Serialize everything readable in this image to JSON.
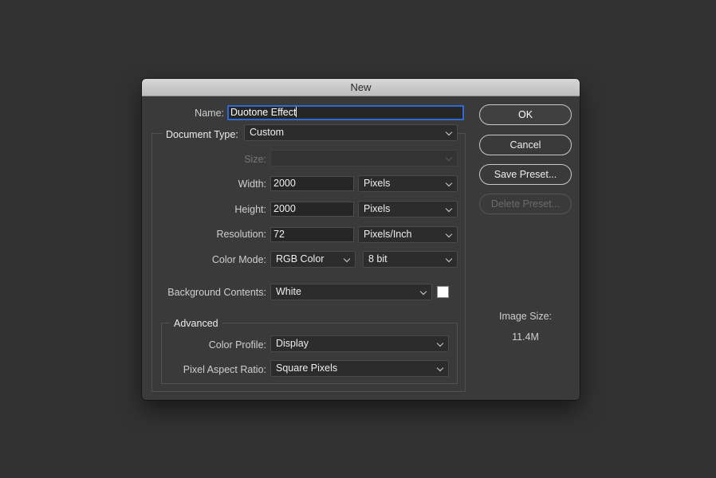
{
  "dialog": {
    "title": "New"
  },
  "name": {
    "label": "Name:",
    "value": "Duotone Effect"
  },
  "document_type": {
    "label": "Document Type:",
    "value": "Custom"
  },
  "size": {
    "label": "Size:",
    "value": ""
  },
  "width": {
    "label": "Width:",
    "value": "2000",
    "unit": "Pixels"
  },
  "height": {
    "label": "Height:",
    "value": "2000",
    "unit": "Pixels"
  },
  "resolution": {
    "label": "Resolution:",
    "value": "72",
    "unit": "Pixels/Inch"
  },
  "color_mode": {
    "label": "Color Mode:",
    "value": "RGB Color",
    "depth": "8 bit"
  },
  "background": {
    "label": "Background Contents:",
    "value": "White",
    "swatch_color": "#ffffff"
  },
  "advanced": {
    "title": "Advanced",
    "color_profile": {
      "label": "Color Profile:",
      "value": "Display"
    },
    "pixel_aspect": {
      "label": "Pixel Aspect Ratio:",
      "value": "Square Pixels"
    }
  },
  "buttons": {
    "ok": "OK",
    "cancel": "Cancel",
    "save_preset": "Save Preset...",
    "delete_preset": "Delete Preset..."
  },
  "image_size": {
    "label": "Image Size:",
    "value": "11.4M"
  },
  "colors": {
    "accent": "#2f6ad1",
    "background": "#323232",
    "dialog": "#3a3a3a"
  }
}
